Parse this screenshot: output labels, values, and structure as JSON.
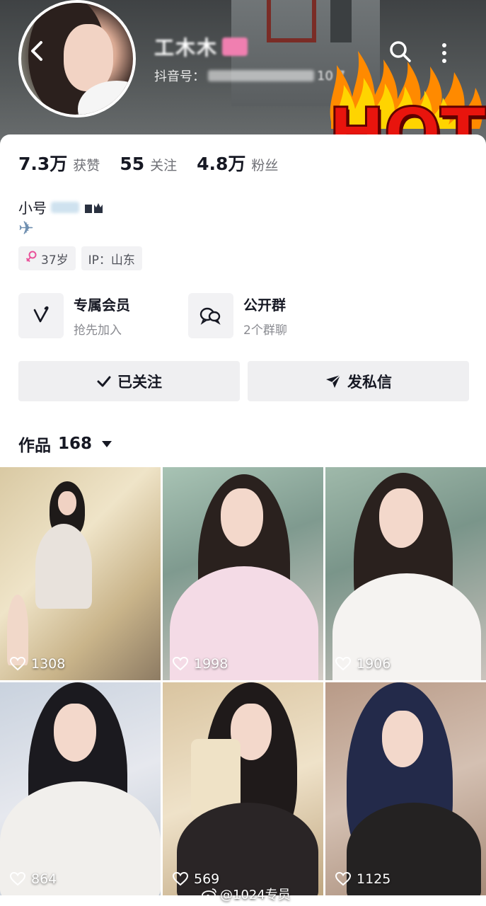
{
  "header": {
    "nickname": "工木木",
    "douyin_id_label": "抖音号：",
    "douyin_id_tail": "10 7"
  },
  "badge": {
    "text": "HOT"
  },
  "stats": [
    {
      "value": "7.3万",
      "label": "获赞"
    },
    {
      "value": "55",
      "label": "关注"
    },
    {
      "value": "4.8万",
      "label": "粉丝"
    }
  ],
  "bio": {
    "prefix": "小号",
    "emoji": "✈"
  },
  "tags": {
    "age": "37岁",
    "ip": "IP：山东"
  },
  "features": [
    {
      "title": "专属会员",
      "subtitle": "抢先加入"
    },
    {
      "title": "公开群",
      "subtitle": "2个群聊"
    }
  ],
  "actions": {
    "followed": "已关注",
    "message": "发私信"
  },
  "works": {
    "title": "作品",
    "count": "168"
  },
  "videos": [
    {
      "likes": "1308"
    },
    {
      "likes": "1998"
    },
    {
      "likes": "1906"
    },
    {
      "likes": "864"
    },
    {
      "likes": "569"
    },
    {
      "likes": "1125"
    }
  ],
  "watermark": "@1024专员",
  "colors": {
    "accent_red": "#e8140d",
    "female_pink": "#e9529a",
    "button_bg": "#efeff1"
  }
}
